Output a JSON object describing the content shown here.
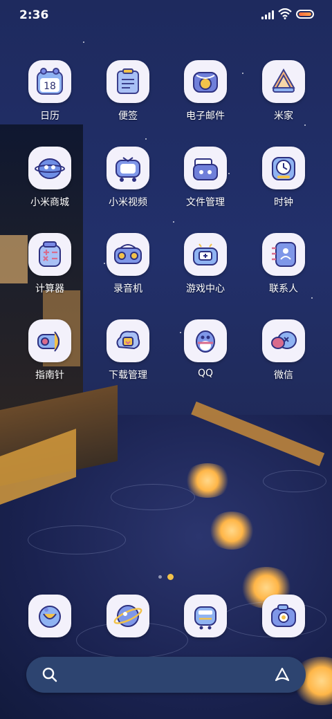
{
  "status": {
    "time": "2:36"
  },
  "apps": [
    {
      "label": "日历",
      "icon": "calendar-icon",
      "badge": "18"
    },
    {
      "label": "便签",
      "icon": "notes-icon"
    },
    {
      "label": "电子邮件",
      "icon": "email-icon"
    },
    {
      "label": "米家",
      "icon": "mijia-icon"
    },
    {
      "label": "小米商城",
      "icon": "mi-store-icon"
    },
    {
      "label": "小米视频",
      "icon": "mi-video-icon"
    },
    {
      "label": "文件管理",
      "icon": "file-manager-icon"
    },
    {
      "label": "时钟",
      "icon": "clock-icon"
    },
    {
      "label": "计算器",
      "icon": "calculator-icon"
    },
    {
      "label": "录音机",
      "icon": "recorder-icon"
    },
    {
      "label": "游戏中心",
      "icon": "game-center-icon"
    },
    {
      "label": "联系人",
      "icon": "contacts-icon"
    },
    {
      "label": "指南针",
      "icon": "compass-icon"
    },
    {
      "label": "下载管理",
      "icon": "downloads-icon"
    },
    {
      "label": "QQ",
      "icon": "qq-icon"
    },
    {
      "label": "微信",
      "icon": "wechat-icon"
    }
  ],
  "dock": [
    {
      "icon": "phone-icon"
    },
    {
      "icon": "messages-icon"
    },
    {
      "icon": "browser-icon"
    },
    {
      "icon": "camera-icon"
    }
  ],
  "colors": {
    "icon_bg": "#f3f1fb",
    "accent": "#f2c24a",
    "search_bg": "#2d4470"
  }
}
